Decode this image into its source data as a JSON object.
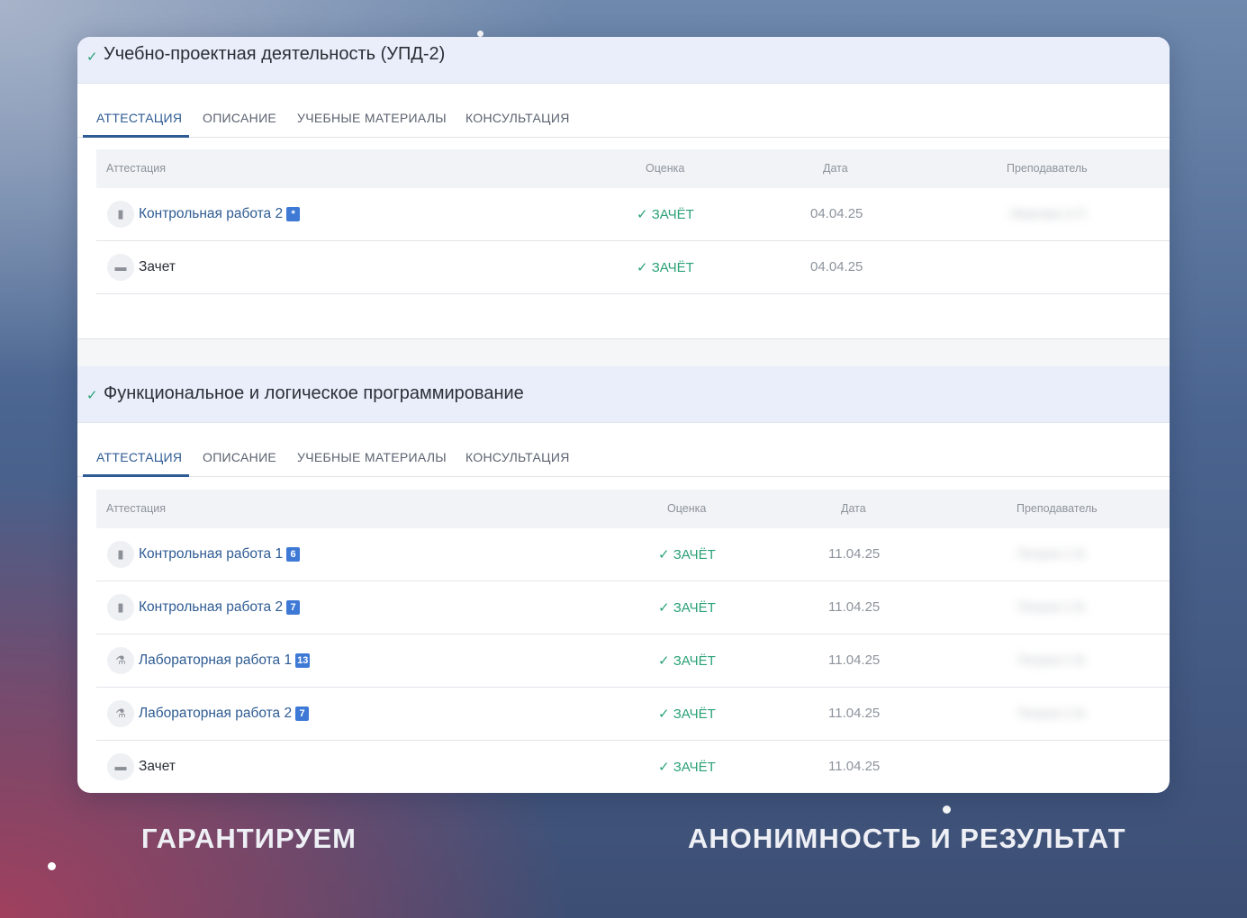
{
  "sections": [
    {
      "title": "Учебно-проектная деятельность (УПД-2)",
      "tabs": [
        "АТТЕСТАЦИЯ",
        "ОПИСАНИЕ",
        "УЧЕБНЫЕ МАТЕРИАЛЫ",
        "КОНСУЛЬТАЦИЯ"
      ],
      "headers": {
        "attestation": "Аттестация",
        "grade": "Оценка",
        "date": "Дата",
        "teacher": "Преподаватель"
      },
      "rows": [
        {
          "name": "Контрольная работа 2",
          "badge": "*",
          "grade": "ЗАЧЁТ",
          "date": "04.04.25",
          "teacher": "Иванова А.П."
        },
        {
          "name": "Зачет",
          "grade": "ЗАЧЁТ",
          "date": "04.04.25"
        }
      ]
    },
    {
      "title": "Функциональное и логическое программирование",
      "tabs": [
        "АТТЕСТАЦИЯ",
        "ОПИСАНИЕ",
        "УЧЕБНЫЕ МАТЕРИАЛЫ",
        "КОНСУЛЬТАЦИЯ"
      ],
      "headers": {
        "attestation": "Аттестация",
        "grade": "Оценка",
        "date": "Дата",
        "teacher": "Преподаватель"
      },
      "rows": [
        {
          "name": "Контрольная работа 1",
          "badge": "6",
          "grade": "ЗАЧЁТ",
          "date": "11.04.25",
          "teacher": "Петров С.В."
        },
        {
          "name": "Контрольная работа 2",
          "badge": "7",
          "grade": "ЗАЧЁТ",
          "date": "11.04.25",
          "teacher": "Петров С.В."
        },
        {
          "name": "Лабораторная работа 1",
          "badge": "13",
          "grade": "ЗАЧЁТ",
          "date": "11.04.25",
          "teacher": "Петров С.В."
        },
        {
          "name": "Лабораторная работа 2",
          "badge": "7",
          "grade": "ЗАЧЁТ",
          "date": "11.04.25",
          "teacher": "Петров С.В."
        },
        {
          "name": "Зачет",
          "grade": "ЗАЧЁТ",
          "date": "11.04.25"
        }
      ]
    }
  ],
  "captions": {
    "left": "ГАРАНТИРУЕМ",
    "right": "АНОНИМНОСТЬ И РЕЗУЛЬТАТ"
  },
  "colors": {
    "accent": "#2e5b93",
    "success": "#2aa176",
    "badge": "#3e79d6",
    "header_bg": "#e9eefa"
  }
}
